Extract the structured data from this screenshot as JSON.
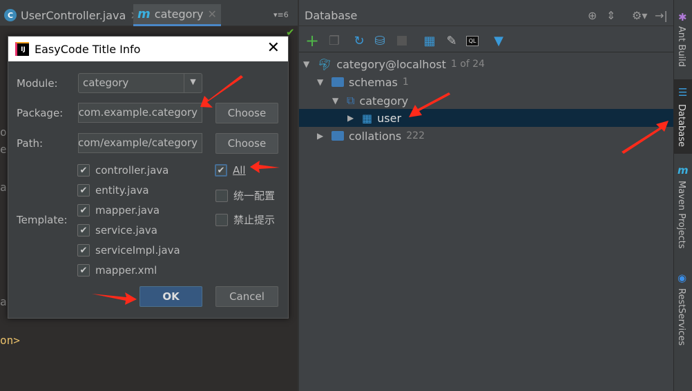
{
  "editor": {
    "tabs": [
      {
        "label": "UserController.java",
        "icon": "class-c-icon",
        "active": false
      },
      {
        "label": "category",
        "icon": "maven-m-icon",
        "active": true
      }
    ],
    "tab_count": "6",
    "code_fragments": [
      "oc",
      "er",
      "ar",
      "ar",
      "on>"
    ]
  },
  "dialog": {
    "title": "EasyCode Title Info",
    "module_label": "Module:",
    "module_value": "category",
    "package_label": "Package:",
    "package_value": "com.example.category",
    "path_label": "Path:",
    "path_value": "com/example/category",
    "choose_label": "Choose",
    "template_label": "Template:",
    "templates": [
      {
        "label": "controller.java",
        "checked": true
      },
      {
        "label": "entity.java",
        "checked": true
      },
      {
        "label": "mapper.java",
        "checked": true
      },
      {
        "label": "service.java",
        "checked": true
      },
      {
        "label": "serviceImpl.java",
        "checked": true
      },
      {
        "label": "mapper.xml",
        "checked": true
      }
    ],
    "options": [
      {
        "label": "All",
        "checked": true
      },
      {
        "label": "统一配置",
        "checked": false
      },
      {
        "label": "禁止提示",
        "checked": false
      }
    ],
    "ok_label": "OK",
    "cancel_label": "Cancel"
  },
  "database": {
    "title": "Database",
    "tree": {
      "datasource": "category@localhost",
      "datasource_count": "1 of 24",
      "schemas": "schemas",
      "schemas_count": "1",
      "schema": "category",
      "table": "user",
      "collations": "collations",
      "collations_count": "222"
    }
  },
  "side_strip": [
    "Ant Build",
    "Database",
    "Maven Projects",
    "RestServices"
  ],
  "colors": {
    "accent": "#4a88c7",
    "selection": "#0d293e",
    "primary_button": "#365880",
    "annotation": "#ff2a1a"
  }
}
